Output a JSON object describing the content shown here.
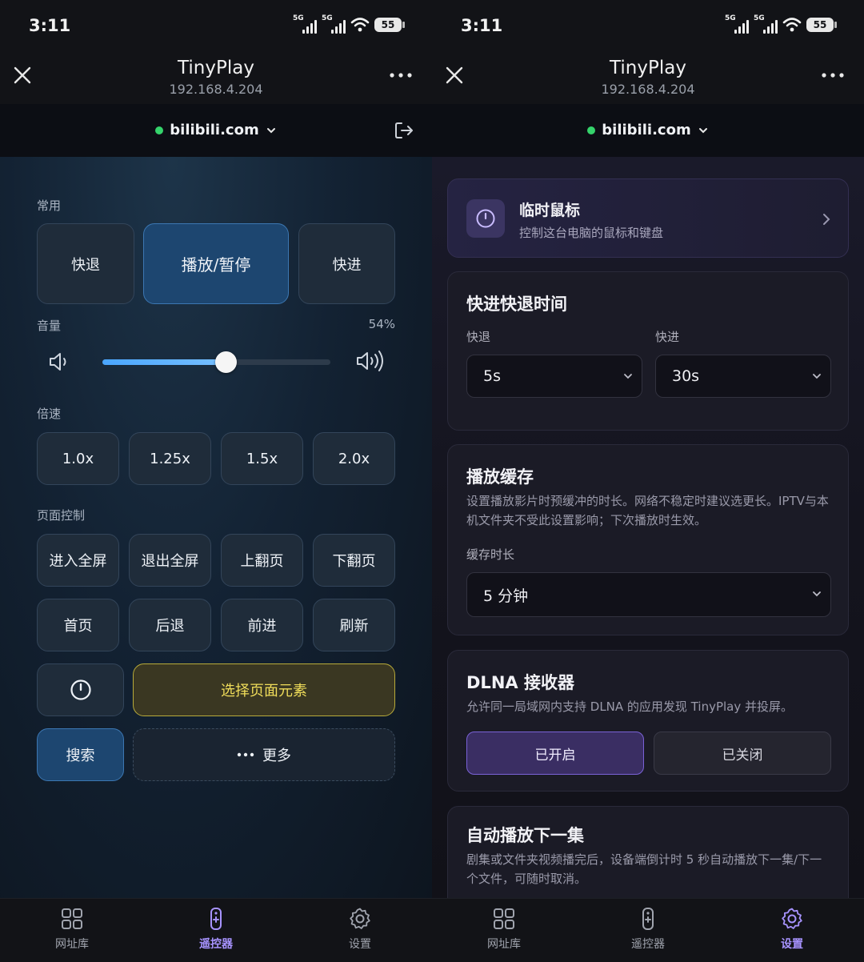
{
  "left": {
    "status": {
      "time": "3:11",
      "signal1": "5G",
      "signal2": "5G",
      "battery": "55"
    },
    "header": {
      "title": "TinyPlay",
      "ip": "192.168.4.204"
    },
    "site": {
      "name": "bilibili.com"
    },
    "common": {
      "label": "常用",
      "rewind": "快退",
      "play_pause": "播放/暂停",
      "forward": "快进"
    },
    "volume": {
      "label": "音量",
      "percent_text": "54%",
      "value": 0.54
    },
    "speed": {
      "label": "倍速",
      "options": [
        "1.0x",
        "1.25x",
        "1.5x",
        "2.0x"
      ]
    },
    "page_control": {
      "label": "页面控制",
      "row1": [
        "进入全屏",
        "退出全屏",
        "上翻页",
        "下翻页"
      ],
      "row2": [
        "首页",
        "后退",
        "前进",
        "刷新"
      ],
      "select_element": "选择页面元素",
      "search": "搜索",
      "more": "更多"
    },
    "nav": {
      "items": [
        "网址库",
        "遥控器",
        "设置"
      ],
      "active": 1
    }
  },
  "right": {
    "status": {
      "time": "3:11",
      "signal1": "5G",
      "signal2": "5G",
      "battery": "55"
    },
    "header": {
      "title": "TinyPlay",
      "ip": "192.168.4.204"
    },
    "site": {
      "name": "bilibili.com"
    },
    "mouse": {
      "title": "临时鼠标",
      "desc": "控制这台电脑的鼠标和键盘"
    },
    "seek": {
      "title": "快进快退时间",
      "rewind_label": "快退",
      "rewind_value": "5s",
      "forward_label": "快进",
      "forward_value": "30s"
    },
    "cache": {
      "title": "播放缓存",
      "desc": "设置播放影片时预缓冲的时长。网络不稳定时建议选更长。IPTV与本机文件夹不受此设置影响；下次播放时生效。",
      "field_label": "缓存时长",
      "value": "5 分钟"
    },
    "dlna": {
      "title": "DLNA 接收器",
      "desc": "允许同一局域网内支持 DLNA 的应用发现 TinyPlay 并投屏。",
      "on": "已开启",
      "off": "已关闭"
    },
    "autoplay": {
      "title": "自动播放下一集",
      "desc": "剧集或文件夹视频播完后，设备端倒计时 5 秒自动播放下一集/下一个文件，可随时取消。"
    },
    "nav": {
      "items": [
        "网址库",
        "遥控器",
        "设置"
      ],
      "active": 2
    }
  },
  "colors": {
    "accent_blue": "#1d4670",
    "accent_purple": "#a793ff",
    "highlight_yellow": "#f0dd5a",
    "online_green": "#35d36b"
  },
  "icons": [
    "close-icon",
    "more-icon",
    "chevron-down-icon",
    "exit-icon",
    "volume-low-icon",
    "volume-high-icon",
    "power-icon",
    "grid-icon",
    "remote-icon",
    "gear-icon",
    "chevron-right-icon"
  ]
}
